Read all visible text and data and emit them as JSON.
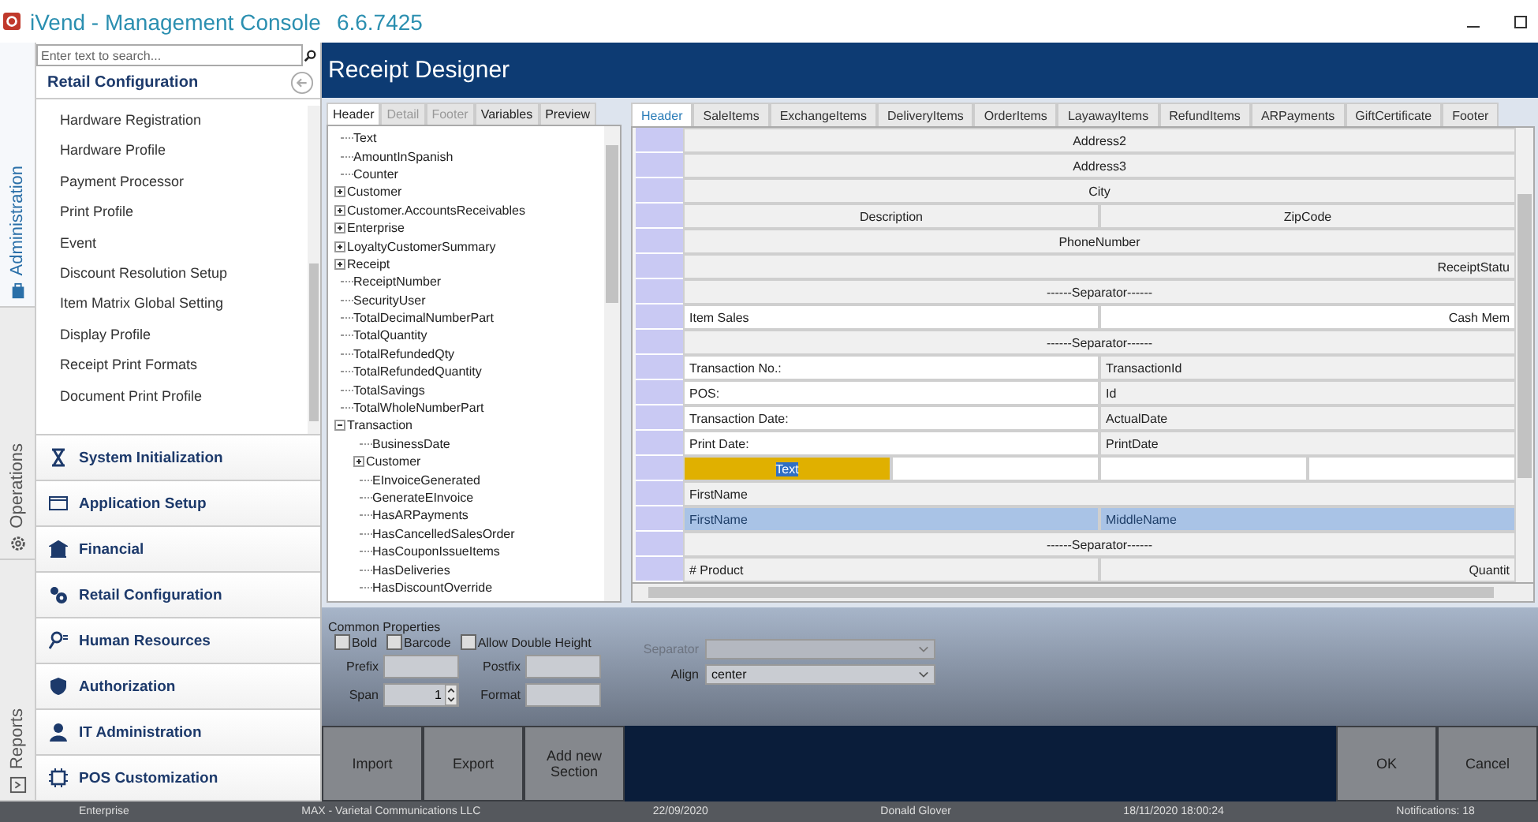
{
  "window": {
    "title": "iVend - Management Console",
    "version": "6.6.7425"
  },
  "side_tabs": [
    {
      "label": "Administration",
      "selected": true
    },
    {
      "label": "Operations",
      "selected": false
    },
    {
      "label": "Reports",
      "selected": false
    }
  ],
  "sidebar": {
    "search": {
      "placeholder": "Enter text to search..."
    },
    "title": "Retail Configuration",
    "items": [
      "Hardware Registration",
      "Hardware Profile",
      "Payment Processor",
      "Print Profile",
      "Event",
      "Discount Resolution Setup",
      "Item Matrix Global Setting",
      "Display Profile",
      "Receipt Print Formats",
      "Document Print Profile"
    ],
    "sections": [
      "System Initialization",
      "Application Setup",
      "Financial",
      "Retail Configuration",
      "Human Resources",
      "Authorization",
      "IT Administration",
      "POS Customization"
    ]
  },
  "designer": {
    "title": "Receipt Designer",
    "field_tabs": [
      {
        "label": "Header",
        "selected": true,
        "disabled": false
      },
      {
        "label": "Detail",
        "selected": false,
        "disabled": true
      },
      {
        "label": "Footer",
        "selected": false,
        "disabled": true
      },
      {
        "label": "Variables",
        "selected": false,
        "disabled": false
      },
      {
        "label": "Preview",
        "selected": false,
        "disabled": false
      }
    ],
    "tree": [
      {
        "label": "Text"
      },
      {
        "label": "AmountInSpanish"
      },
      {
        "label": "Counter"
      },
      {
        "label": "Customer",
        "expanded": false
      },
      {
        "label": "Customer.AccountsReceivables",
        "expanded": false
      },
      {
        "label": "Enterprise",
        "expanded": false
      },
      {
        "label": "LoyaltyCustomerSummary",
        "expanded": false
      },
      {
        "label": "Receipt",
        "expanded": false
      },
      {
        "label": "ReceiptNumber"
      },
      {
        "label": "SecurityUser"
      },
      {
        "label": "TotalDecimalNumberPart"
      },
      {
        "label": "TotalQuantity"
      },
      {
        "label": "TotalRefundedQty"
      },
      {
        "label": "TotalRefundedQuantity"
      },
      {
        "label": "TotalSavings"
      },
      {
        "label": "TotalWholeNumberPart"
      },
      {
        "label": "Transaction",
        "expanded": true,
        "children": [
          {
            "label": "BusinessDate"
          },
          {
            "label": "Customer",
            "expanded": false
          },
          {
            "label": "EInvoiceGenerated"
          },
          {
            "label": "GenerateEInvoice"
          },
          {
            "label": "HasARPayments"
          },
          {
            "label": "HasCancelledSalesOrder"
          },
          {
            "label": "HasCouponIssueItems"
          },
          {
            "label": "HasDeliveries"
          },
          {
            "label": "HasDiscountOverride"
          }
        ]
      }
    ],
    "section_tabs": [
      {
        "label": "Header",
        "selected": true
      },
      {
        "label": "SaleItems",
        "selected": false
      },
      {
        "label": "ExchangeItems",
        "selected": false
      },
      {
        "label": "DeliveryItems",
        "selected": false
      },
      {
        "label": "OrderItems",
        "selected": false
      },
      {
        "label": "LayawayItems",
        "selected": false
      },
      {
        "label": "RefundItems",
        "selected": false
      },
      {
        "label": "ARPayments",
        "selected": false
      },
      {
        "label": "GiftCertificate",
        "selected": false
      },
      {
        "label": "Footer",
        "selected": false
      }
    ],
    "rows": [
      {
        "selected": false,
        "cells": [
          {
            "text": "Address2",
            "kind": "heading",
            "selected": false
          }
        ]
      },
      {
        "selected": false,
        "cells": [
          {
            "text": "Address3",
            "kind": "heading",
            "selected": false
          }
        ]
      },
      {
        "selected": false,
        "cells": [
          {
            "text": "City",
            "kind": "heading",
            "selected": false
          }
        ]
      },
      {
        "selected": false,
        "cells": [
          {
            "text": "Description",
            "kind": "heading",
            "selected": false
          },
          {
            "text": "ZipCode",
            "kind": "heading",
            "selected": false
          }
        ]
      },
      {
        "selected": false,
        "cells": [
          {
            "text": "PhoneNumber",
            "kind": "heading",
            "selected": false
          }
        ]
      },
      {
        "selected": false,
        "cells": [
          {
            "text": "ReceiptStatu",
            "kind": "value",
            "selected": false
          }
        ]
      },
      {
        "selected": false,
        "cells": [
          {
            "text": "------Separator------",
            "kind": "heading",
            "selected": false
          }
        ]
      },
      {
        "selected": false,
        "cells": [
          {
            "text": "Item Sales",
            "kind": "literal",
            "selected": false
          },
          {
            "text": "Cash Mem",
            "kind": "label",
            "selected": false
          }
        ]
      },
      {
        "selected": false,
        "cells": [
          {
            "text": "------Separator------",
            "kind": "heading",
            "selected": false
          }
        ]
      },
      {
        "selected": false,
        "cells": [
          {
            "text": "Transaction No.:",
            "kind": "literal",
            "selected": false
          },
          {
            "text": "TransactionId",
            "kind": "field",
            "selected": false
          }
        ]
      },
      {
        "selected": false,
        "cells": [
          {
            "text": "POS:",
            "kind": "literal",
            "selected": false
          },
          {
            "text": "Id",
            "kind": "field",
            "selected": false
          }
        ]
      },
      {
        "selected": false,
        "cells": [
          {
            "text": "Transaction Date:",
            "kind": "literal",
            "selected": false
          },
          {
            "text": "ActualDate",
            "kind": "field",
            "selected": false
          }
        ]
      },
      {
        "selected": false,
        "cells": [
          {
            "text": "Print Date:",
            "kind": "literal",
            "selected": false
          },
          {
            "text": "PrintDate",
            "kind": "field",
            "selected": false
          }
        ]
      },
      {
        "selected": false,
        "cells": [
          {
            "text": "Text",
            "kind": "literal",
            "selected": true
          },
          {
            "kind": "literal",
            "selected": false
          },
          {
            "kind": "literal",
            "selected": false
          },
          {
            "kind": "literal",
            "selected": false
          }
        ]
      },
      {
        "selected": false,
        "cells": [
          {
            "text": "FirstName",
            "kind": "field",
            "selected": false
          }
        ]
      },
      {
        "selected": true,
        "cells": [
          {
            "text": "FirstName",
            "kind": "field",
            "selected": false
          },
          {
            "text": "MiddleName",
            "kind": "field",
            "selected": false
          }
        ]
      },
      {
        "selected": false,
        "cells": [
          {
            "text": "------Separator------",
            "kind": "heading",
            "selected": false
          }
        ]
      },
      {
        "selected": false,
        "cells": [
          {
            "text": "# Product",
            "kind": "field",
            "selected": false
          },
          {
            "text": "Quantit",
            "kind": "value",
            "selected": false
          }
        ]
      }
    ]
  },
  "properties": {
    "title": "Common Properties",
    "checkboxes": [
      {
        "label": "Bold",
        "checked": false
      },
      {
        "label": "Barcode",
        "checked": false
      },
      {
        "label": "Allow Double Height",
        "checked": false
      }
    ],
    "prefix": {
      "label": "Prefix"
    },
    "postfix": {
      "label": "Postfix"
    },
    "span": {
      "label": "Span",
      "value": "1"
    },
    "format": {
      "label": "Format"
    },
    "separator": {
      "label": "Separator",
      "disabled": true
    },
    "align": {
      "label": "Align",
      "value": "center",
      "disabled": false
    }
  },
  "actions": [
    "Import",
    "Export",
    "Add new Section"
  ],
  "dialog_buttons": [
    "OK",
    "Cancel"
  ],
  "status_bar": [
    "Enterprise",
    "MAX - Varietal Communications LLC",
    "22/09/2020",
    "Donald Glover",
    "18/11/2020 18:00:24",
    "Notifications: 18"
  ]
}
